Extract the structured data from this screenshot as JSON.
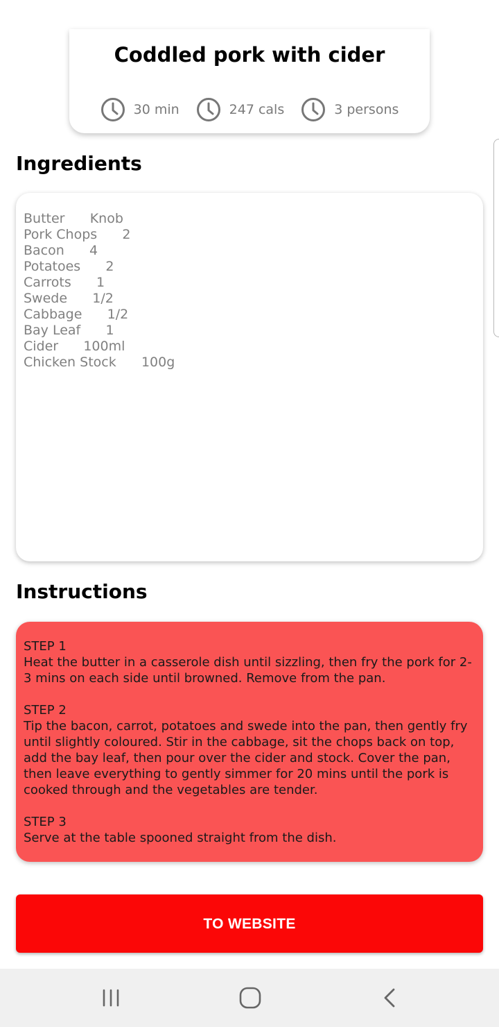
{
  "recipe": {
    "title": "Coddled pork with cider",
    "meta": [
      {
        "icon": "clock-icon",
        "label": "30 min"
      },
      {
        "icon": "clock-icon",
        "label": "247 cals"
      },
      {
        "icon": "clock-icon",
        "label": "3 persons"
      }
    ]
  },
  "ingredients": {
    "heading": "Ingredients",
    "items": [
      "Butter      Knob",
      "Pork Chops      2",
      "Bacon      4",
      "Potatoes      2",
      "Carrots      1",
      "Swede      1/2",
      "Cabbage      1/2",
      "Bay Leaf      1",
      "Cider      100ml",
      "Chicken Stock      100g"
    ]
  },
  "instructions": {
    "heading": "Instructions",
    "steps": [
      {
        "label": "STEP 1",
        "text": "Heat the butter in a casserole dish until sizzling, then fry the pork for 2-3 mins on each side until browned. Remove from the pan."
      },
      {
        "label": "STEP 2",
        "text": "Tip the bacon, carrot, potatoes and swede into the pan, then gently fry until slightly coloured. Stir in the cabbage, sit the chops back on top, add the bay leaf, then pour over the cider and stock. Cover the pan, then leave everything to gently simmer for 20 mins until the pork is cooked through and the vegetables are tender."
      },
      {
        "label": "STEP 3",
        "text": "Serve at the table spooned straight from the dish."
      }
    ]
  },
  "website_button": {
    "label": "TO WEBSITE"
  },
  "colors": {
    "accent_red": "#fb0707",
    "instructions_bg": "#fa5454",
    "muted_text": "#808080",
    "nav_bg": "#f0f0f0"
  },
  "nav": {
    "recents_icon": "recents-icon",
    "home_icon": "home-icon",
    "back_icon": "back-icon"
  }
}
